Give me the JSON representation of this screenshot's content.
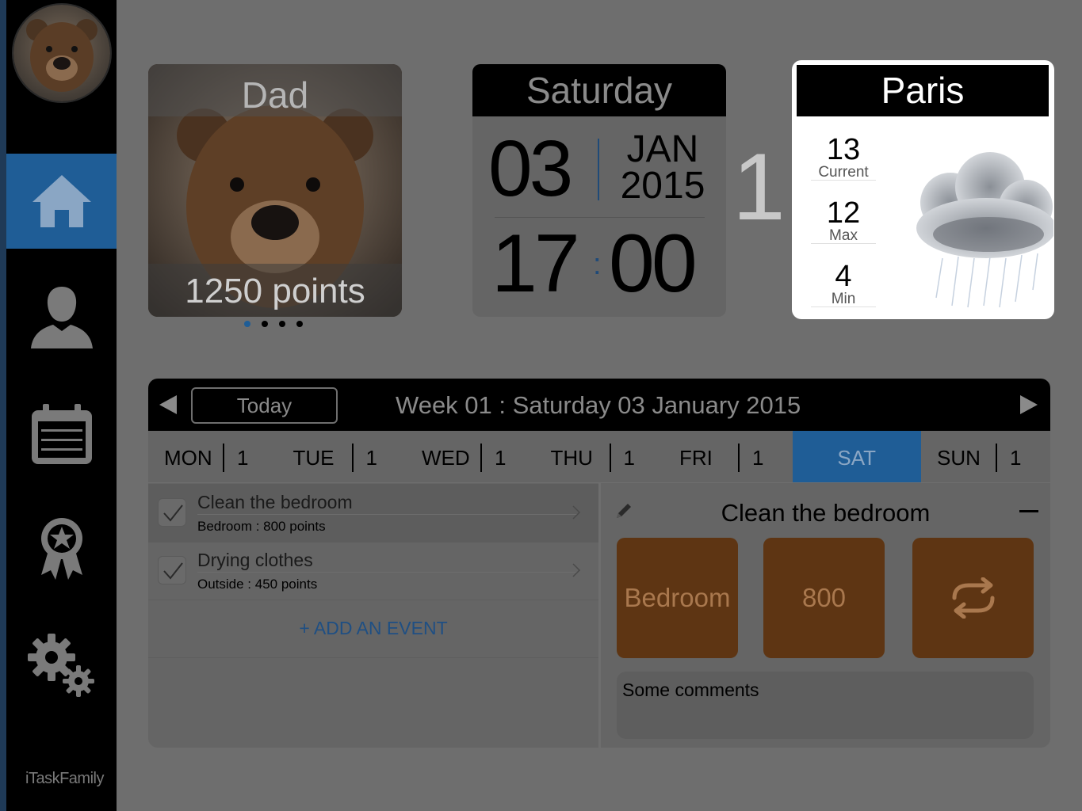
{
  "sidebar": {
    "items": [
      {
        "key": "home",
        "icon": "home-icon",
        "active": true
      },
      {
        "key": "profile",
        "icon": "person-icon",
        "active": false
      },
      {
        "key": "calendar",
        "icon": "calendar-icon",
        "active": false
      },
      {
        "key": "rewards",
        "icon": "award-ribbon-icon",
        "active": false
      },
      {
        "key": "settings",
        "icon": "gear-icon",
        "active": false
      }
    ],
    "brand": "iTaskFamily"
  },
  "profile": {
    "name": "Dad",
    "points": "1250 points",
    "page_count": 4,
    "page_active": 0
  },
  "datetime": {
    "weekday": "Saturday",
    "day": "03",
    "month": "JAN",
    "year": "2015",
    "hours": "17",
    "minutes": "00",
    "side_number": "1"
  },
  "weather": {
    "city": "Paris",
    "current_value": "13",
    "current_label": "Current",
    "max_value": "12",
    "max_label": "Max",
    "min_value": "4",
    "min_label": "Min",
    "icon": "rain-cloud-icon"
  },
  "week": {
    "today_label": "Today",
    "title": "Week 01 : Saturday 03 January 2015",
    "days": [
      {
        "name": "MON",
        "count": "1",
        "active": false
      },
      {
        "name": "TUE",
        "count": "1",
        "active": false
      },
      {
        "name": "WED",
        "count": "1",
        "active": false
      },
      {
        "name": "THU",
        "count": "1",
        "active": false
      },
      {
        "name": "FRI",
        "count": "1",
        "active": false
      },
      {
        "name": "SAT",
        "count": "",
        "active": true
      },
      {
        "name": "SUN",
        "count": "1",
        "active": false
      }
    ]
  },
  "events": {
    "items": [
      {
        "title": "Clean the bedroom",
        "subtitle": "Bedroom : 800 points",
        "selected": true
      },
      {
        "title": "Drying clothes",
        "subtitle": "Outside : 450 points",
        "selected": false
      }
    ],
    "add_label": "+ ADD AN EVENT"
  },
  "detail": {
    "title": "Clean the bedroom",
    "room": "Bedroom",
    "points": "800",
    "comments": "Some comments"
  },
  "colors": {
    "accent": "#1f5d96",
    "tile": "#5e3513",
    "background": "#6e6e6e"
  }
}
